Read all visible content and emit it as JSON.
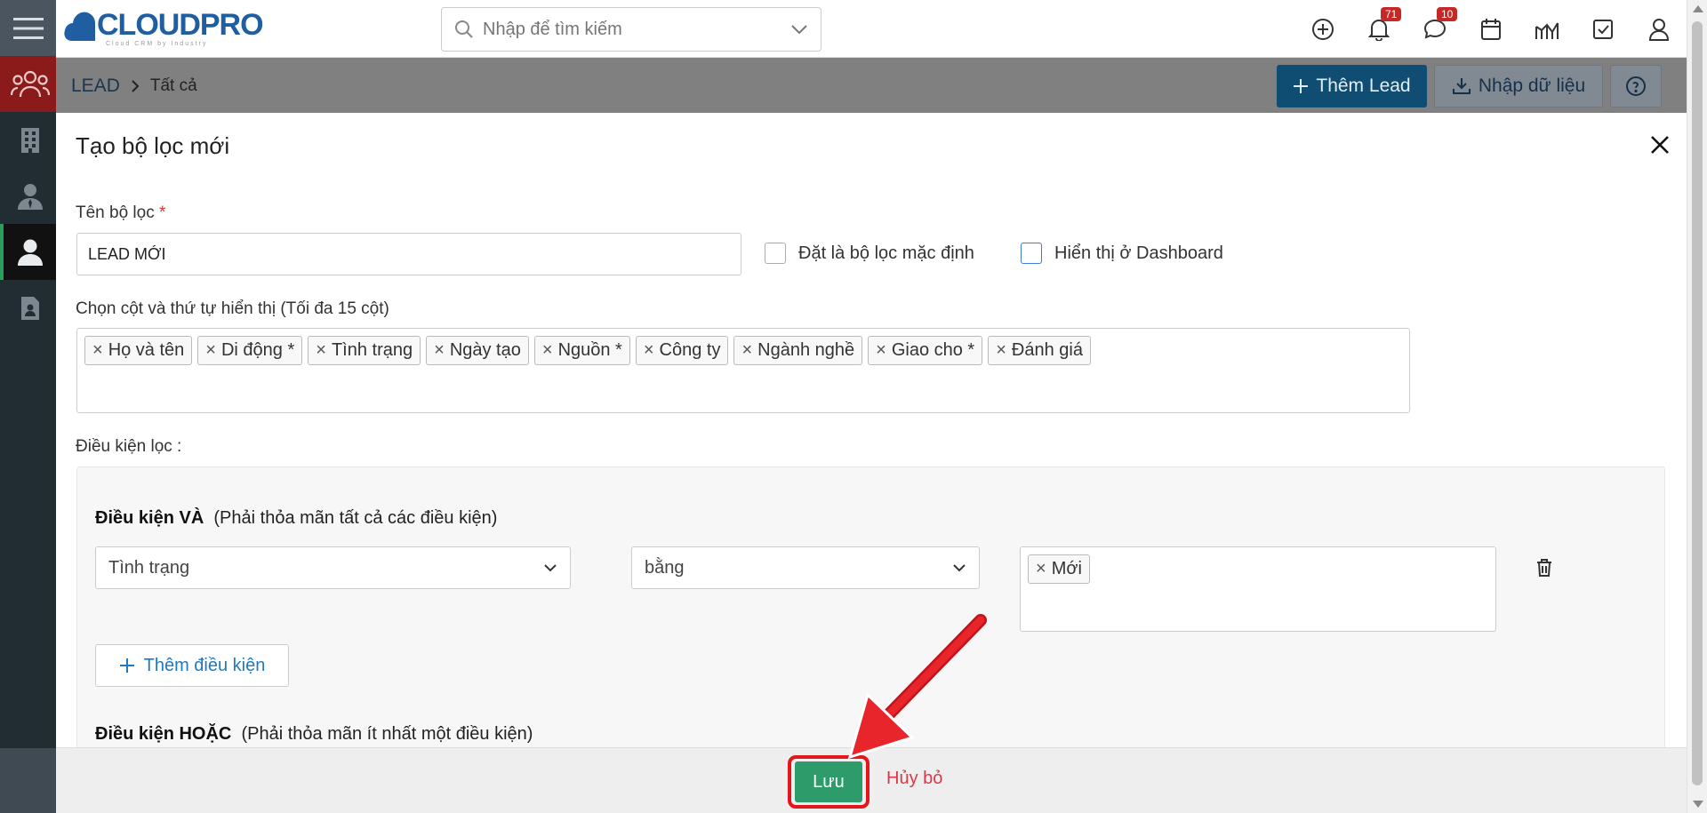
{
  "app": {
    "logo": {
      "main": "CLOUDPRO",
      "sub": "Cloud CRM by Industry"
    },
    "search": {
      "placeholder": "Nhập để tìm kiếm"
    },
    "notifications": {
      "bell_count": "71",
      "chat_count": "10"
    }
  },
  "breadcrumb": {
    "module": "LEAD",
    "view": "Tất cả"
  },
  "actions": {
    "add": "Thêm Lead",
    "import": "Nhập dữ liệu"
  },
  "modal": {
    "title": "Tạo bộ lọc mới",
    "name_label": "Tên bộ lọc",
    "name_required_mark": "*",
    "name_value": "LEAD MỚI",
    "default_filter_label": "Đặt là bộ lọc mặc định",
    "dashboard_label": "Hiển thị ở Dashboard",
    "columns_label": "Chọn cột và thứ tự hiển thị (Tối đa 15 cột)",
    "columns": [
      "Họ và tên",
      "Di động *",
      "Tình trạng",
      "Ngày tạo",
      "Nguồn *",
      "Công ty",
      "Ngành nghề",
      "Giao cho *",
      "Đánh giá"
    ],
    "conditions_label": "Điều kiện lọc :",
    "and_group": {
      "title": "Điều kiện VÀ",
      "desc": "(Phải thỏa mãn tất cả các điều kiện)",
      "field": "Tình trạng",
      "operator": "bằng",
      "values": [
        "Mới"
      ],
      "add_label": "Thêm điều kiện"
    },
    "or_group": {
      "title": "Điều kiện HOẶC",
      "desc": "(Phải thỏa mãn ít nhất một điều kiện)"
    }
  },
  "footer": {
    "save": "Lưu",
    "cancel": "Hủy bỏ"
  },
  "colors": {
    "brand": "#1e5ea1",
    "save": "#2e9c6a",
    "highlight": "#e3161c",
    "cancel": "#d63a4a",
    "sidebar": "#222c33"
  }
}
